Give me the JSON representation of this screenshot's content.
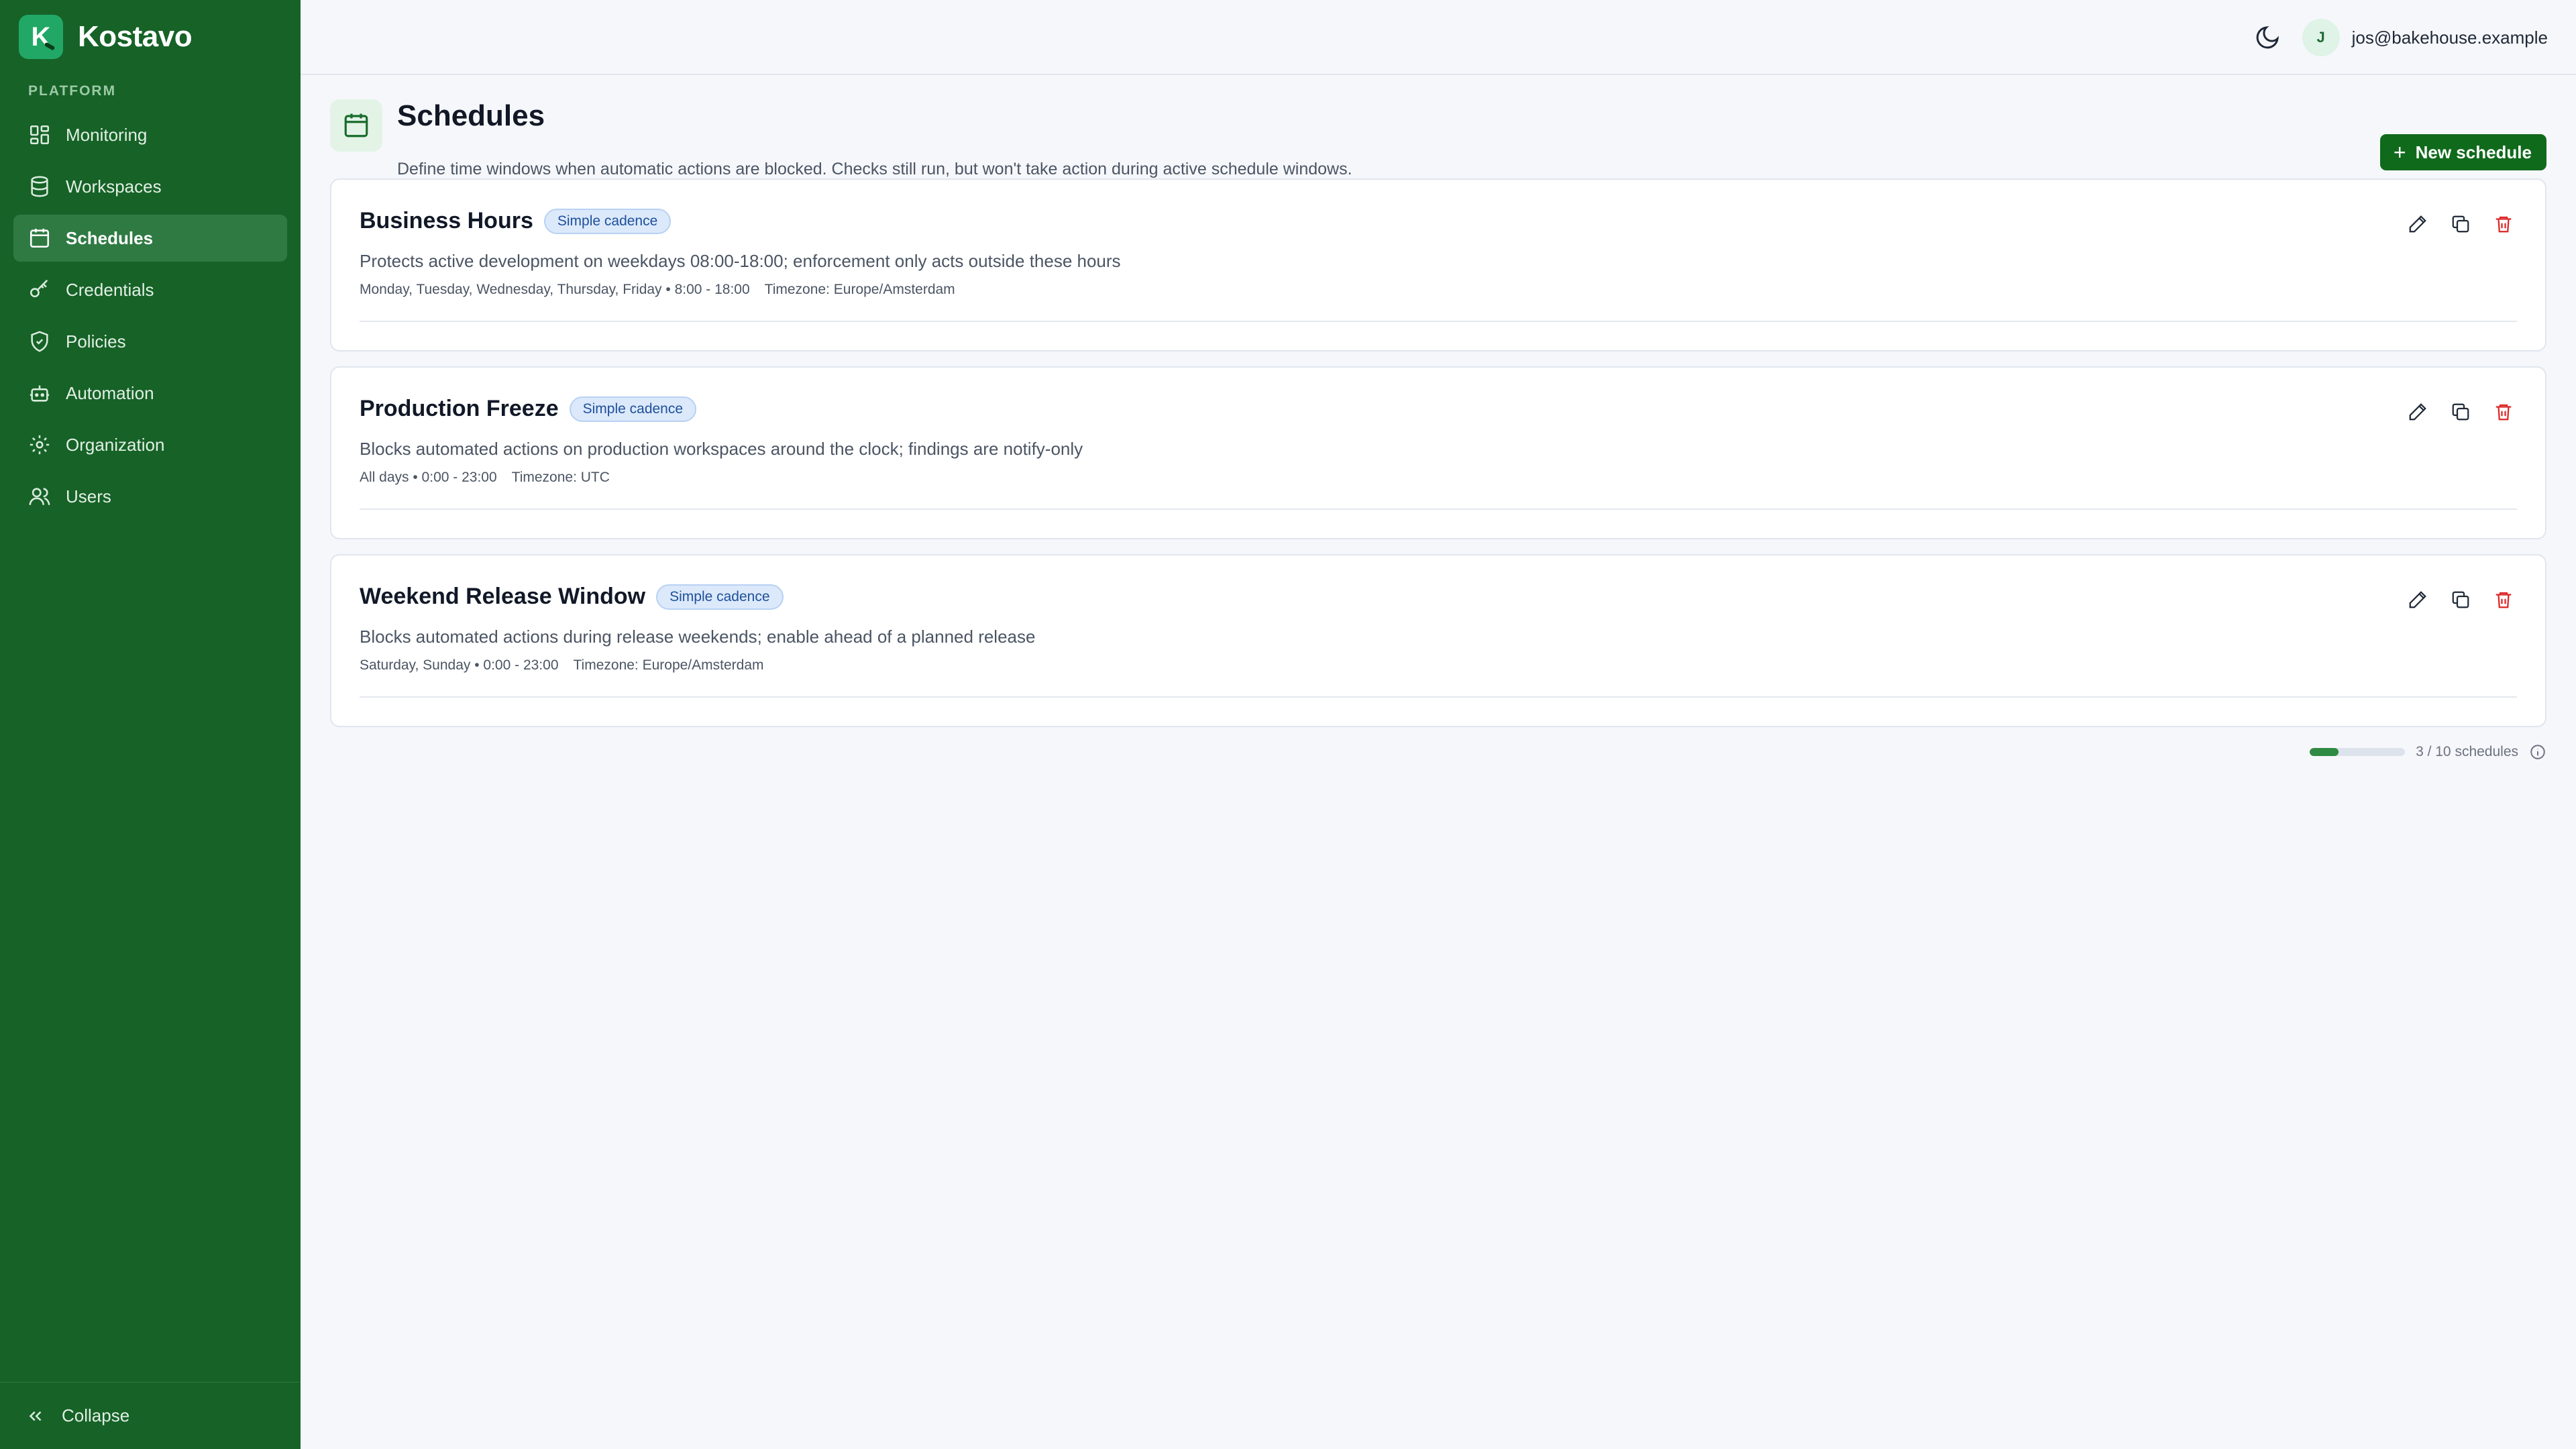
{
  "app": {
    "name": "Kostavo",
    "logo_letter": "K"
  },
  "sidebar": {
    "section_label": "PLATFORM",
    "items": [
      {
        "label": "Monitoring",
        "icon": "dashboard-icon"
      },
      {
        "label": "Workspaces",
        "icon": "database-icon"
      },
      {
        "label": "Schedules",
        "icon": "calendar-icon",
        "active": true
      },
      {
        "label": "Credentials",
        "icon": "key-icon"
      },
      {
        "label": "Policies",
        "icon": "shield-icon"
      },
      {
        "label": "Automation",
        "icon": "bot-icon"
      },
      {
        "label": "Organization",
        "icon": "gear-icon"
      },
      {
        "label": "Users",
        "icon": "users-icon"
      }
    ],
    "collapse_label": "Collapse"
  },
  "topbar": {
    "user_initial": "J",
    "user_email": "jos@bakehouse.example"
  },
  "page": {
    "title": "Schedules",
    "description": "Define time windows when automatic actions are blocked. Checks still run, but won't take action during active schedule windows.",
    "new_button": "New schedule"
  },
  "schedules": [
    {
      "title": "Business Hours",
      "badge": "Simple cadence",
      "description": "Protects active development on weekdays 08:00-18:00; enforcement only acts outside these hours",
      "when": "Monday, Tuesday, Wednesday, Thursday, Friday • 8:00 - 18:00",
      "timezone": "Timezone: Europe/Amsterdam"
    },
    {
      "title": "Production Freeze",
      "badge": "Simple cadence",
      "description": "Blocks automated actions on production workspaces around the clock; findings are notify-only",
      "when": "All days • 0:00 - 23:00",
      "timezone": "Timezone: UTC"
    },
    {
      "title": "Weekend Release Window",
      "badge": "Simple cadence",
      "description": "Blocks automated actions during release weekends; enable ahead of a planned release",
      "when": "Saturday, Sunday • 0:00 - 23:00",
      "timezone": "Timezone: Europe/Amsterdam"
    }
  ],
  "quota": {
    "text": "3 / 10 schedules",
    "used": 3,
    "limit": 10
  },
  "colors": {
    "sidebar": "#166227",
    "accent": "#106a1c",
    "danger": "#dc2626",
    "badge": "#dbe9fb"
  }
}
